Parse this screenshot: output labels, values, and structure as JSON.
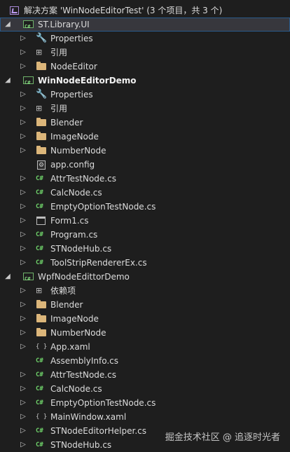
{
  "solution": {
    "label": "解决方案 'WinNodeEditorTest' (3 个项目，共 3 个)"
  },
  "projects": [
    {
      "label": "ST.Library.UI",
      "items": [
        {
          "label": "Properties",
          "icon": "wrench-icon"
        },
        {
          "label": "引用",
          "icon": "references-icon"
        },
        {
          "label": "NodeEditor",
          "icon": "folder-icon"
        }
      ]
    },
    {
      "label": "WinNodeEditorDemo",
      "items": [
        {
          "label": "Properties",
          "icon": "wrench-icon"
        },
        {
          "label": "引用",
          "icon": "references-icon"
        },
        {
          "label": "Blender",
          "icon": "folder-icon"
        },
        {
          "label": "ImageNode",
          "icon": "folder-icon"
        },
        {
          "label": "NumberNode",
          "icon": "folder-icon"
        },
        {
          "label": "app.config",
          "icon": "config-file-icon"
        },
        {
          "label": "AttrTestNode.cs",
          "icon": "csharp-file-icon"
        },
        {
          "label": "CalcNode.cs",
          "icon": "csharp-file-icon"
        },
        {
          "label": "EmptyOptionTestNode.cs",
          "icon": "csharp-file-icon"
        },
        {
          "label": "Form1.cs",
          "icon": "form-icon"
        },
        {
          "label": "Program.cs",
          "icon": "csharp-file-icon"
        },
        {
          "label": "STNodeHub.cs",
          "icon": "csharp-file-icon"
        },
        {
          "label": "ToolStripRendererEx.cs",
          "icon": "csharp-file-icon"
        }
      ]
    },
    {
      "label": "WpfNodeEdittorDemo",
      "items": [
        {
          "label": "依赖项",
          "icon": "dependencies-icon"
        },
        {
          "label": "Blender",
          "icon": "folder-icon"
        },
        {
          "label": "ImageNode",
          "icon": "folder-icon"
        },
        {
          "label": "NumberNode",
          "icon": "folder-icon"
        },
        {
          "label": "App.xaml",
          "icon": "xaml-file-icon"
        },
        {
          "label": "AssemblyInfo.cs",
          "icon": "csharp-file-icon"
        },
        {
          "label": "AttrTestNode.cs",
          "icon": "csharp-file-icon"
        },
        {
          "label": "CalcNode.cs",
          "icon": "csharp-file-icon"
        },
        {
          "label": "EmptyOptionTestNode.cs",
          "icon": "csharp-file-icon"
        },
        {
          "label": "MainWindow.xaml",
          "icon": "xaml-file-icon"
        },
        {
          "label": "STNodeEditorHelper.cs",
          "icon": "csharp-file-icon"
        },
        {
          "label": "STNodeHub.cs",
          "icon": "csharp-file-icon"
        }
      ]
    }
  ],
  "watermark": "掘金技术社区 @ 追逐时光者",
  "colors": {
    "background": "#1e1e1e",
    "text": "#dcdcdc",
    "folder": "#dcb67a",
    "csharp": "#6fd36a",
    "selection": "#37373d"
  }
}
